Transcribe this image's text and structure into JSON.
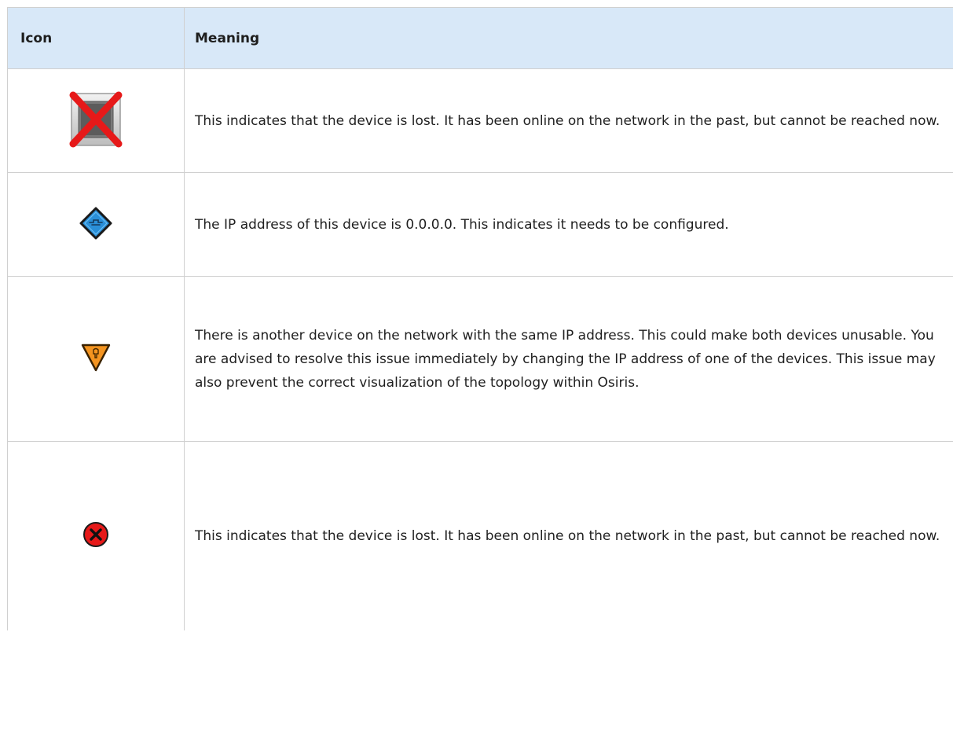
{
  "table": {
    "headers": {
      "icon": "Icon",
      "meaning": "Meaning"
    },
    "rows": [
      {
        "icon": "lost-device-red-x-icon",
        "meaning": "This indicates that the device is lost. It has been online on the network in the past, but cannot be reached now."
      },
      {
        "icon": "unconfigured-ip-blue-diamond-icon",
        "meaning": "The IP address of this device is 0.0.0.0. This indicates it needs to be configured."
      },
      {
        "icon": "ip-conflict-orange-triangle-icon",
        "meaning": "There is another device on the network with the same IP address. This could make both devices unusable. You are advised to resolve this issue immediately by changing the IP address of one of the devices. This issue may also prevent the correct visualization of the topology within Osiris."
      },
      {
        "icon": "lost-device-red-circle-x-icon",
        "meaning": "This indicates that the device is lost. It has been online on the network in the past, but cannot be reached now."
      }
    ]
  },
  "colors": {
    "header_bg": "#d8e8f8",
    "border": "#d0d0d0",
    "error_red": "#e61919",
    "config_blue": "#2a8fd8",
    "warning_orange": "#f49420"
  }
}
